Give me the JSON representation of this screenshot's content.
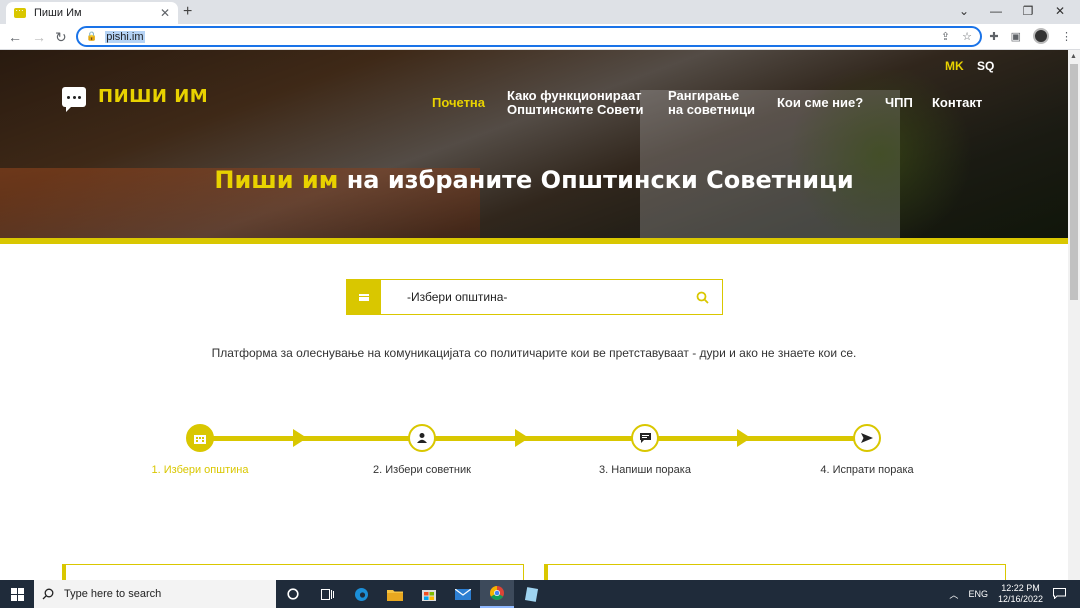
{
  "browser": {
    "tab_title": "Пиши Им",
    "url": "pishi.im",
    "new_tab": "+",
    "tab_close": "✕",
    "window_controls": {
      "minimize": "—",
      "restore": "❐",
      "close": "✕",
      "chevron": "⌄"
    }
  },
  "site": {
    "logo_text": "ПИШИ ИМ",
    "languages": [
      {
        "label": "MK",
        "active": true
      },
      {
        "label": "SQ",
        "active": false
      }
    ],
    "nav": [
      {
        "line1": "Почетна",
        "line2": "",
        "active": true
      },
      {
        "line1": "Како функционираат",
        "line2": "Општинските Совети",
        "active": false
      },
      {
        "line1": "Рангирање",
        "line2": "на советници",
        "active": false
      },
      {
        "line1": "Кои сме ние?",
        "line2": "",
        "active": false
      },
      {
        "line1": "ЧПП",
        "line2": "",
        "active": false
      },
      {
        "line1": "Контакт",
        "line2": "",
        "active": false
      }
    ],
    "hero_title_highlight": "Пиши им",
    "hero_title_rest": " на избраните Општински Советници",
    "search_value": "-Избери општина-",
    "tagline": "Платформа за олеснување на комуникацијата со политичарите кои ве претставуваат - дури и ако не знаете кои се.",
    "steps": [
      {
        "label": "1. Избери општина",
        "icon": "building-icon",
        "active": true
      },
      {
        "label": "2. Избери советник",
        "icon": "person-icon",
        "active": false
      },
      {
        "label": "3. Напиши порака",
        "icon": "message-icon",
        "active": false
      },
      {
        "label": "4. Испрати порака",
        "icon": "send-icon",
        "active": false
      }
    ]
  },
  "taskbar": {
    "search_placeholder": "Type here to search",
    "lang": "ENG",
    "time": "12:22 PM",
    "date": "12/16/2022"
  },
  "colors": {
    "accent": "#d9c700",
    "address_focus": "#1a73e8",
    "taskbar": "#1f2b3a"
  }
}
